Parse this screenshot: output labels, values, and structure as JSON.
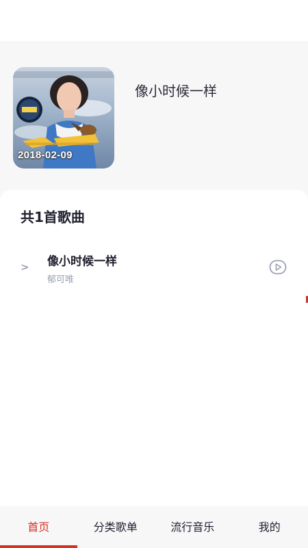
{
  "header": {
    "playlist_title": "像小时候一样",
    "cover": {
      "date_text": "2018-02-09"
    }
  },
  "song_list": {
    "count_label": "共1首歌曲",
    "songs": [
      {
        "chevron": ">",
        "title": "像小时候一样",
        "artist": "郁可唯",
        "action_icon": "play-circle-icon"
      }
    ]
  },
  "tabbar": {
    "tabs": [
      {
        "label": "首页",
        "active": true
      },
      {
        "label": "分类歌单",
        "active": false
      },
      {
        "label": "流行音乐",
        "active": false
      },
      {
        "label": "我的",
        "active": false
      }
    ],
    "active_color": "#d9301f"
  }
}
